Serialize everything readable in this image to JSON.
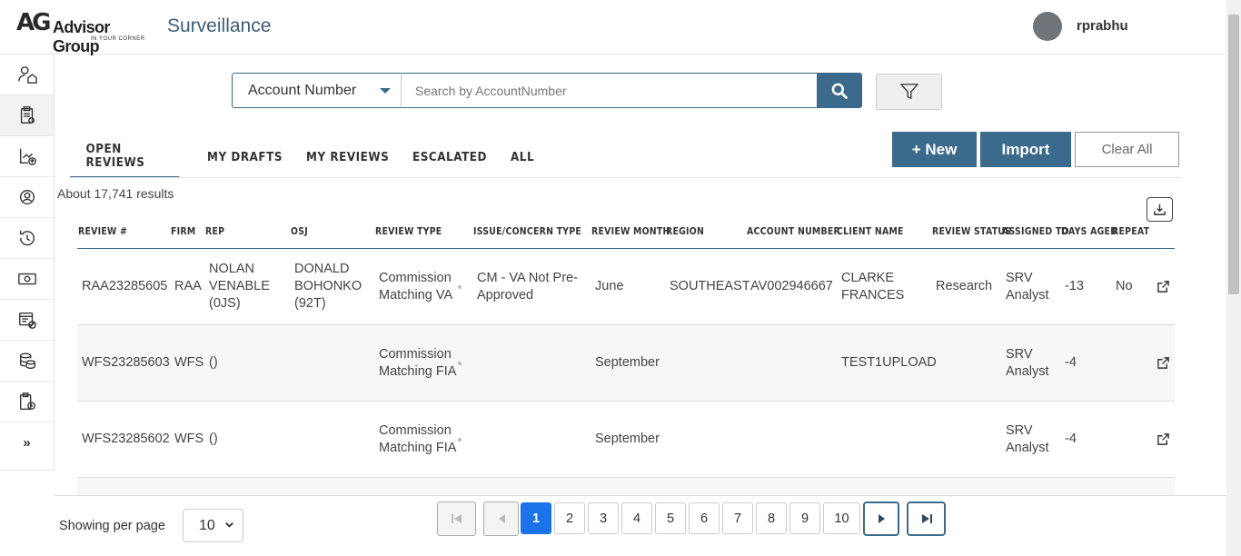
{
  "header": {
    "logo_mark": "AG",
    "logo_name": "Advisor Group",
    "logo_tagline": "IN YOUR CORNER",
    "app_title": "Surveillance",
    "username": "rprabhu"
  },
  "sidebar": {
    "items": [
      {
        "name": "user-home-icon"
      },
      {
        "name": "clipboard-check-icon"
      },
      {
        "name": "chart-upload-icon"
      },
      {
        "name": "user-circle-icon"
      },
      {
        "name": "history-icon"
      },
      {
        "name": "money-icon"
      },
      {
        "name": "document-block-icon"
      },
      {
        "name": "coins-stack-icon"
      },
      {
        "name": "clipboard-clock-icon"
      },
      {
        "name": "expand-icon",
        "label": "»"
      }
    ]
  },
  "search": {
    "field_label": "Account Number",
    "placeholder": "Search by AccountNumber",
    "value": ""
  },
  "tabs": [
    "OPEN REVIEWS",
    "MY DRAFTS",
    "MY REVIEWS",
    "ESCALATED",
    "ALL"
  ],
  "actions": {
    "new_label": "+ New",
    "import_label": "Import",
    "clear_label": "Clear All"
  },
  "results_text": "About 17,741 results",
  "table": {
    "columns": [
      "REVIEW #",
      "FIRM",
      "REP",
      "OSJ",
      "REVIEW TYPE",
      "ISSUE/CONCERN TYPE",
      "REVIEW MONTH",
      "REGION",
      "ACCOUNT NUMBER",
      "CLIENT NAME",
      "REVIEW STATUS",
      "ASSIGNED TO",
      "DAYS AGED",
      "REPEAT"
    ],
    "rows": [
      {
        "review": "RAA23285605",
        "firm": "RAA",
        "rep": "NOLAN VENABLE (0JS)",
        "osj": "DONALD BOHONKO (92T)",
        "type": "Commission Matching VA",
        "issue": "CM - VA Not Pre-Approved",
        "month": "June",
        "region": "SOUTHEAST",
        "account": "AV002946667",
        "client": "CLARKE FRANCES",
        "status": "Research",
        "assigned": "SRV Analyst",
        "days": "-13",
        "repeat": "No"
      },
      {
        "review": "WFS23285603",
        "firm": "WFS",
        "rep": "()",
        "osj": "",
        "type": "Commission Matching FIA",
        "issue": "",
        "month": "September",
        "region": "",
        "account": "",
        "client": "TEST1UPLOAD",
        "status": "",
        "assigned": "SRV Analyst",
        "days": "-4",
        "repeat": ""
      },
      {
        "review": "WFS23285602",
        "firm": "WFS",
        "rep": "()",
        "osj": "",
        "type": "Commission Matching FIA",
        "issue": "",
        "month": "September",
        "region": "",
        "account": "",
        "client": "",
        "status": "",
        "assigned": "SRV Analyst",
        "days": "-4",
        "repeat": ""
      }
    ]
  },
  "pagination": {
    "per_page_label": "Showing per page",
    "per_page_value": "10",
    "pages": [
      "1",
      "2",
      "3",
      "4",
      "5",
      "6",
      "7",
      "8",
      "9",
      "10"
    ],
    "current_page": "1"
  },
  "colors": {
    "primary": "#3b6a8c",
    "active_page": "#1a73e8",
    "title": "#3b5e7a"
  }
}
